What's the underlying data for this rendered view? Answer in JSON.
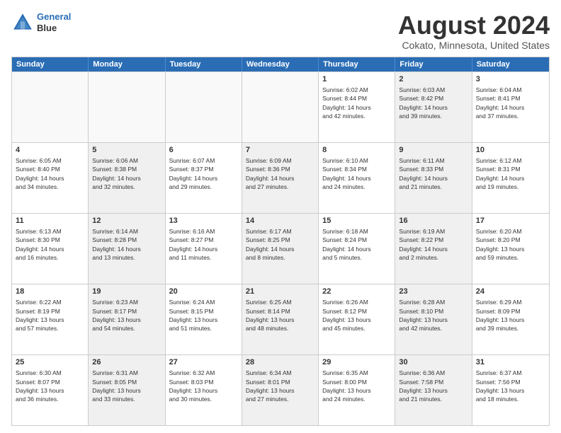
{
  "header": {
    "logo_line1": "General",
    "logo_line2": "Blue",
    "main_title": "August 2024",
    "subtitle": "Cokato, Minnesota, United States"
  },
  "calendar": {
    "days_of_week": [
      "Sunday",
      "Monday",
      "Tuesday",
      "Wednesday",
      "Thursday",
      "Friday",
      "Saturday"
    ],
    "rows": [
      [
        {
          "day": "",
          "info": "",
          "shaded": false,
          "empty": true
        },
        {
          "day": "",
          "info": "",
          "shaded": false,
          "empty": true
        },
        {
          "day": "",
          "info": "",
          "shaded": false,
          "empty": true
        },
        {
          "day": "",
          "info": "",
          "shaded": false,
          "empty": true
        },
        {
          "day": "1",
          "info": "Sunrise: 6:02 AM\nSunset: 8:44 PM\nDaylight: 14 hours\nand 42 minutes.",
          "shaded": false
        },
        {
          "day": "2",
          "info": "Sunrise: 6:03 AM\nSunset: 8:42 PM\nDaylight: 14 hours\nand 39 minutes.",
          "shaded": true
        },
        {
          "day": "3",
          "info": "Sunrise: 6:04 AM\nSunset: 8:41 PM\nDaylight: 14 hours\nand 37 minutes.",
          "shaded": false
        }
      ],
      [
        {
          "day": "4",
          "info": "Sunrise: 6:05 AM\nSunset: 8:40 PM\nDaylight: 14 hours\nand 34 minutes.",
          "shaded": false
        },
        {
          "day": "5",
          "info": "Sunrise: 6:06 AM\nSunset: 8:38 PM\nDaylight: 14 hours\nand 32 minutes.",
          "shaded": true
        },
        {
          "day": "6",
          "info": "Sunrise: 6:07 AM\nSunset: 8:37 PM\nDaylight: 14 hours\nand 29 minutes.",
          "shaded": false
        },
        {
          "day": "7",
          "info": "Sunrise: 6:09 AM\nSunset: 8:36 PM\nDaylight: 14 hours\nand 27 minutes.",
          "shaded": true
        },
        {
          "day": "8",
          "info": "Sunrise: 6:10 AM\nSunset: 8:34 PM\nDaylight: 14 hours\nand 24 minutes.",
          "shaded": false
        },
        {
          "day": "9",
          "info": "Sunrise: 6:11 AM\nSunset: 8:33 PM\nDaylight: 14 hours\nand 21 minutes.",
          "shaded": true
        },
        {
          "day": "10",
          "info": "Sunrise: 6:12 AM\nSunset: 8:31 PM\nDaylight: 14 hours\nand 19 minutes.",
          "shaded": false
        }
      ],
      [
        {
          "day": "11",
          "info": "Sunrise: 6:13 AM\nSunset: 8:30 PM\nDaylight: 14 hours\nand 16 minutes.",
          "shaded": false
        },
        {
          "day": "12",
          "info": "Sunrise: 6:14 AM\nSunset: 8:28 PM\nDaylight: 14 hours\nand 13 minutes.",
          "shaded": true
        },
        {
          "day": "13",
          "info": "Sunrise: 6:16 AM\nSunset: 8:27 PM\nDaylight: 14 hours\nand 11 minutes.",
          "shaded": false
        },
        {
          "day": "14",
          "info": "Sunrise: 6:17 AM\nSunset: 8:25 PM\nDaylight: 14 hours\nand 8 minutes.",
          "shaded": true
        },
        {
          "day": "15",
          "info": "Sunrise: 6:18 AM\nSunset: 8:24 PM\nDaylight: 14 hours\nand 5 minutes.",
          "shaded": false
        },
        {
          "day": "16",
          "info": "Sunrise: 6:19 AM\nSunset: 8:22 PM\nDaylight: 14 hours\nand 2 minutes.",
          "shaded": true
        },
        {
          "day": "17",
          "info": "Sunrise: 6:20 AM\nSunset: 8:20 PM\nDaylight: 13 hours\nand 59 minutes.",
          "shaded": false
        }
      ],
      [
        {
          "day": "18",
          "info": "Sunrise: 6:22 AM\nSunset: 8:19 PM\nDaylight: 13 hours\nand 57 minutes.",
          "shaded": false
        },
        {
          "day": "19",
          "info": "Sunrise: 6:23 AM\nSunset: 8:17 PM\nDaylight: 13 hours\nand 54 minutes.",
          "shaded": true
        },
        {
          "day": "20",
          "info": "Sunrise: 6:24 AM\nSunset: 8:15 PM\nDaylight: 13 hours\nand 51 minutes.",
          "shaded": false
        },
        {
          "day": "21",
          "info": "Sunrise: 6:25 AM\nSunset: 8:14 PM\nDaylight: 13 hours\nand 48 minutes.",
          "shaded": true
        },
        {
          "day": "22",
          "info": "Sunrise: 6:26 AM\nSunset: 8:12 PM\nDaylight: 13 hours\nand 45 minutes.",
          "shaded": false
        },
        {
          "day": "23",
          "info": "Sunrise: 6:28 AM\nSunset: 8:10 PM\nDaylight: 13 hours\nand 42 minutes.",
          "shaded": true
        },
        {
          "day": "24",
          "info": "Sunrise: 6:29 AM\nSunset: 8:09 PM\nDaylight: 13 hours\nand 39 minutes.",
          "shaded": false
        }
      ],
      [
        {
          "day": "25",
          "info": "Sunrise: 6:30 AM\nSunset: 8:07 PM\nDaylight: 13 hours\nand 36 minutes.",
          "shaded": false
        },
        {
          "day": "26",
          "info": "Sunrise: 6:31 AM\nSunset: 8:05 PM\nDaylight: 13 hours\nand 33 minutes.",
          "shaded": true
        },
        {
          "day": "27",
          "info": "Sunrise: 6:32 AM\nSunset: 8:03 PM\nDaylight: 13 hours\nand 30 minutes.",
          "shaded": false
        },
        {
          "day": "28",
          "info": "Sunrise: 6:34 AM\nSunset: 8:01 PM\nDaylight: 13 hours\nand 27 minutes.",
          "shaded": true
        },
        {
          "day": "29",
          "info": "Sunrise: 6:35 AM\nSunset: 8:00 PM\nDaylight: 13 hours\nand 24 minutes.",
          "shaded": false
        },
        {
          "day": "30",
          "info": "Sunrise: 6:36 AM\nSunset: 7:58 PM\nDaylight: 13 hours\nand 21 minutes.",
          "shaded": true
        },
        {
          "day": "31",
          "info": "Sunrise: 6:37 AM\nSunset: 7:56 PM\nDaylight: 13 hours\nand 18 minutes.",
          "shaded": false
        }
      ]
    ]
  }
}
